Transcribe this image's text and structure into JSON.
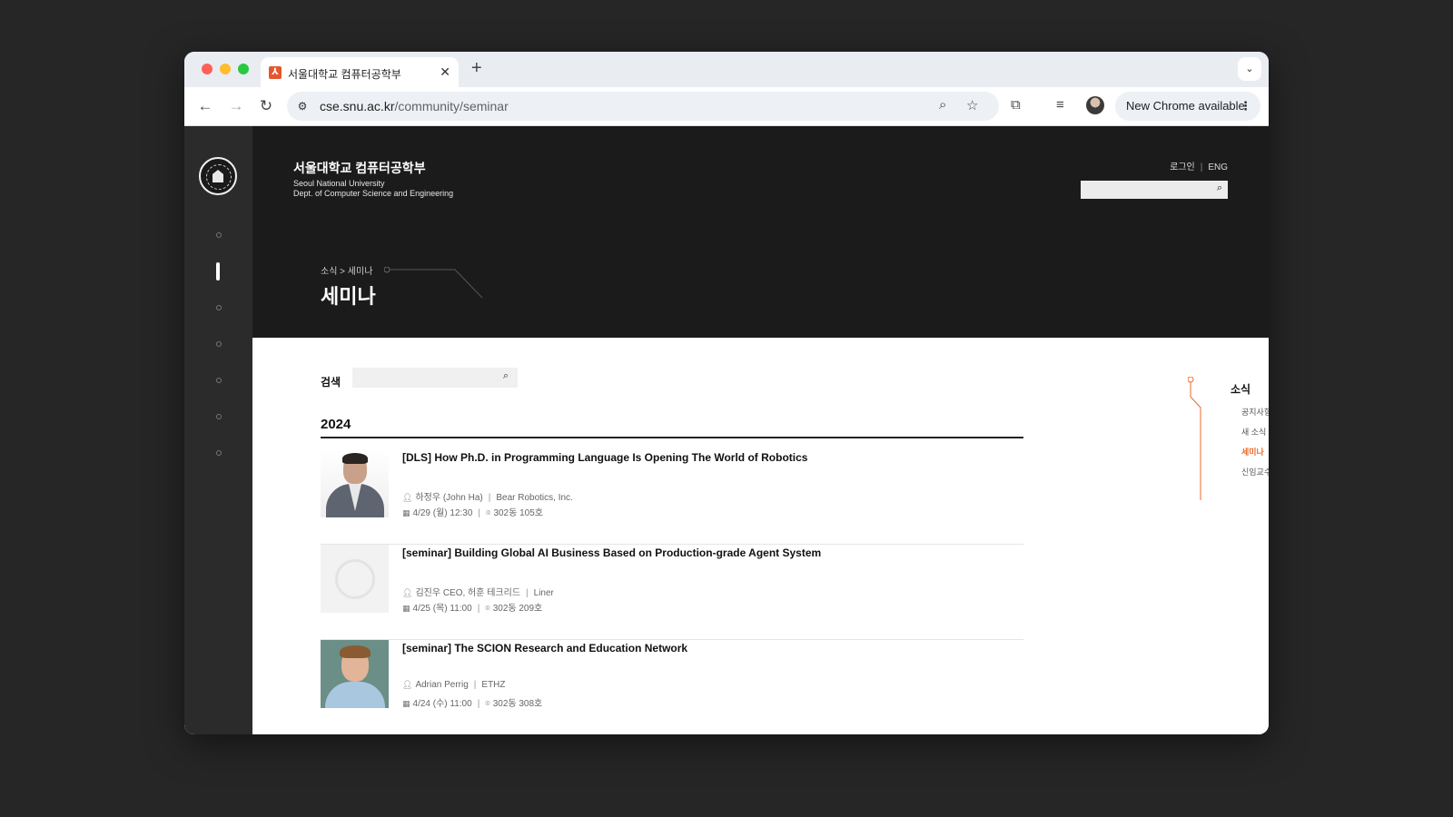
{
  "browser": {
    "tab_title": "서울대학교 컴퓨터공학부",
    "url_domain": "cse.snu.ac.kr",
    "url_path": "/community/seminar",
    "update_label": "New Chrome available"
  },
  "header": {
    "brand_ko": "서울대학교 컴퓨터공학부",
    "brand_en_line1": "Seoul National University",
    "brand_en_line2": "Dept. of Computer Science and Engineering",
    "login": "로그인",
    "lang": "ENG"
  },
  "hero": {
    "breadcrumb": "소식 > 세미나",
    "title": "세미나"
  },
  "search": {
    "label": "검색"
  },
  "year": "2024",
  "seminars": [
    {
      "title": "[DLS] How Ph.D. in Programming Language Is Opening The World of Robotics",
      "speaker": "하정우 (John Ha)",
      "affiliation": "Bear Robotics, Inc.",
      "datetime": "4/29 (월) 12:30",
      "location": "302동 105호"
    },
    {
      "title": "[seminar] Building Global AI Business Based on Production-grade Agent System",
      "speaker": "김진우 CEO, 허훈 테크리드",
      "affiliation": "Liner",
      "datetime": "4/25 (목) 11:00",
      "location": "302동 209호"
    },
    {
      "title": "[seminar] The SCION Research and Education Network",
      "speaker": "Adrian Perrig",
      "affiliation": "ETHZ",
      "datetime": "4/24 (수) 11:00",
      "location": "302동 308호"
    }
  ],
  "subnav": {
    "title": "소식",
    "items": [
      "공지사항",
      "새 소식",
      "세미나",
      "신임교수초빙"
    ],
    "active": "세미나"
  },
  "colors": {
    "accent": "#ec6a2c",
    "hero_bg": "#1b1b1b",
    "sidebar_bg": "#2b2b2b",
    "page_bg": "#262626"
  }
}
